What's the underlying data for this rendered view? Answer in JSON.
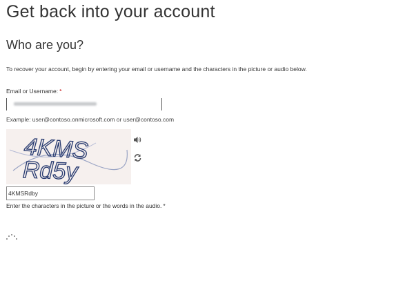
{
  "header": {
    "title": "Get back into your account"
  },
  "form": {
    "section_title": "Who are you?",
    "instructions": "To recover your account, begin by entering your email or username and the characters in the picture or audio below.",
    "email_label": "Email or Username:",
    "required_marker": "*",
    "email_example": "Example: user@contoso.onmicrosoft.com or user@contoso.com",
    "captcha_value": "4KMSRdby",
    "captcha_help": "Enter the characters in the picture or the words in the audio.",
    "captcha_required_marker": "*"
  },
  "captcha": {
    "image_text_line1": "4KMS",
    "image_text_line2": "Rd5y",
    "audio_icon": "speaker-icon",
    "refresh_icon": "refresh-icon"
  },
  "colors": {
    "required": "#c00000",
    "captcha_bg": "#f6f0ee",
    "captcha_ink": "#2d3f73"
  }
}
